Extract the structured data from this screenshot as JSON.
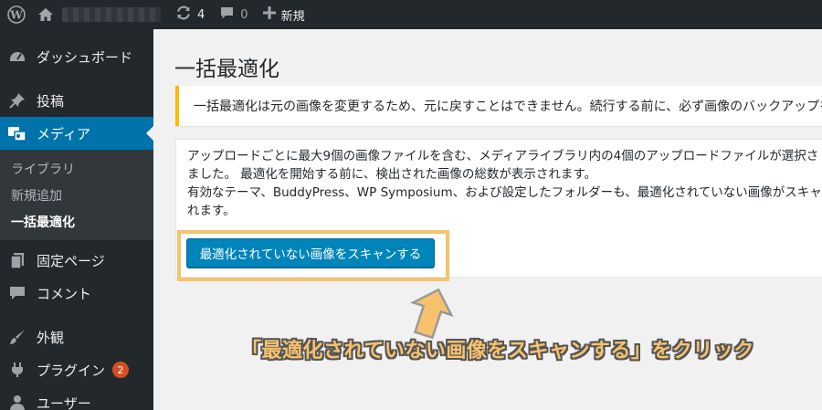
{
  "adminbar": {
    "updates_count": "4",
    "comments_count": "0",
    "new_label": "新規"
  },
  "sidebar": {
    "items": [
      {
        "label": "ダッシュボード",
        "icon": "dashboard-icon"
      },
      {
        "label": "投稿",
        "icon": "pin-icon"
      },
      {
        "label": "メディア",
        "icon": "media-icon"
      },
      {
        "label": "固定ページ",
        "icon": "pages-icon"
      },
      {
        "label": "コメント",
        "icon": "comment-icon"
      },
      {
        "label": "外観",
        "icon": "brush-icon"
      },
      {
        "label": "プラグイン",
        "icon": "plugin-icon",
        "badge": "2"
      },
      {
        "label": "ユーザー",
        "icon": "user-icon"
      }
    ],
    "submenu": [
      "ライブラリ",
      "新規追加",
      "一括最適化"
    ]
  },
  "main": {
    "title": "一括最適化",
    "notice": "一括最適化は元の画像を変更するため、元に戻すことはできません。続行する前に、必ず画像のバックアップを",
    "card_lines": [
      "アップロードごとに最大9個の画像ファイルを含む、メディアライブラリ内の4個のアップロードファイルが選択さ",
      "ました。 最適化を開始する前に、検出された画像の総数が表示されます。",
      "有効なテーマ、BuddyPress、WP Symposium、および設定したフォルダーも、最適化されていない画像がスキャ",
      "れます。"
    ],
    "scan_button": "最適化されていない画像をスキャンする"
  },
  "annotation": {
    "caption": "「最適化されていない画像をスキャンする」をクリック",
    "highlight_color": "#f6c26e"
  },
  "colors": {
    "adminbar": "#23282d",
    "accent": "#0073aa",
    "button": "#0085ba",
    "notice_border": "#ffb900",
    "badge": "#d54e21"
  }
}
